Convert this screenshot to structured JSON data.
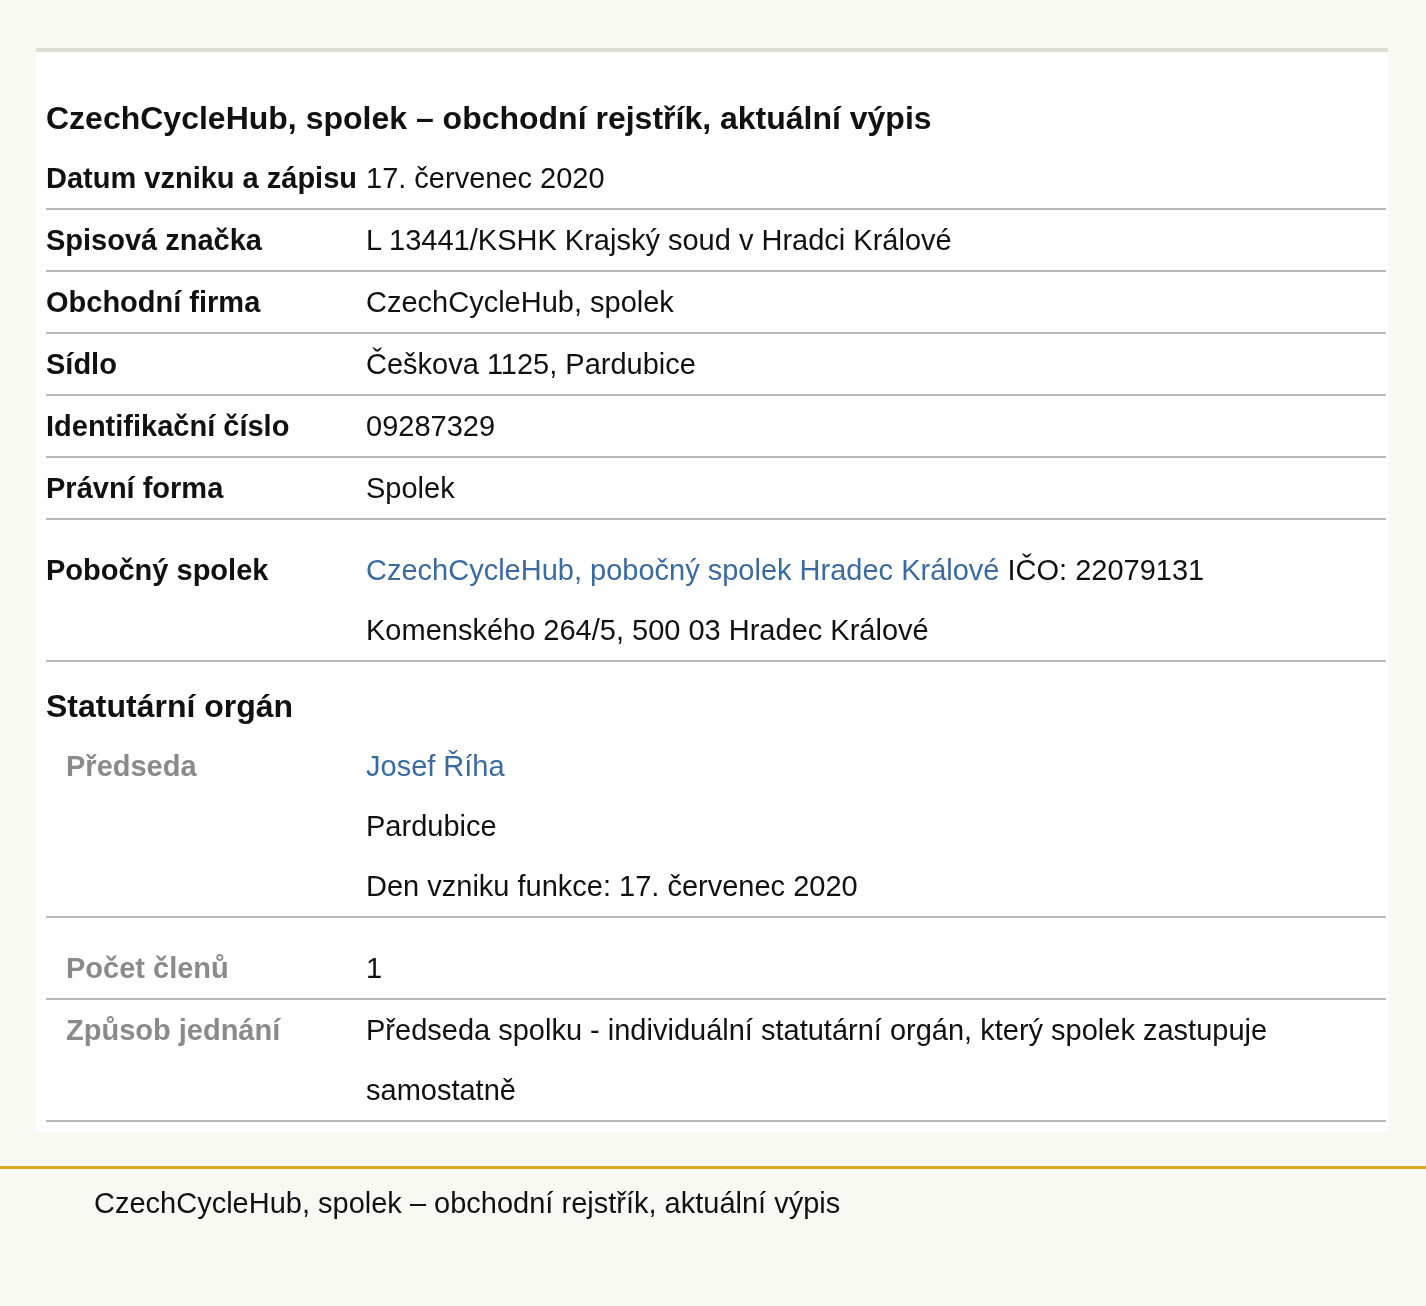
{
  "title": "CzechCycleHub, spolek – obchodní rejstřík, aktuální výpis",
  "rows": [
    {
      "label": "Datum vzniku a zápisu",
      "lines": [
        [
          {
            "kind": "text",
            "text": "17. červenec 2020"
          }
        ]
      ]
    },
    {
      "label": "Spisová značka",
      "lines": [
        [
          {
            "kind": "text",
            "text": "L 13441/KSHK Krajský soud v Hradci Králové"
          }
        ]
      ]
    },
    {
      "label": "Obchodní firma",
      "lines": [
        [
          {
            "kind": "text",
            "text": "CzechCycleHub, spolek"
          }
        ]
      ]
    },
    {
      "label": "Sídlo",
      "lines": [
        [
          {
            "kind": "text",
            "text": "Češkova 1125, Pardubice"
          }
        ]
      ]
    },
    {
      "label": "Identifikační číslo",
      "lines": [
        [
          {
            "kind": "text",
            "text": "09287329"
          }
        ]
      ]
    },
    {
      "label": "Právní forma",
      "lines": [
        [
          {
            "kind": "text",
            "text": "Spolek"
          }
        ]
      ]
    },
    {
      "label": "Pobočný spolek",
      "spaced": true,
      "lines": [
        [
          {
            "kind": "link",
            "text": "CzechCycleHub, pobočný spolek Hradec Králové"
          },
          {
            "kind": "text",
            "text": "IČO: 22079131"
          }
        ],
        [
          {
            "kind": "text",
            "text": "Komenského 264/5, 500 03 Hradec Králové"
          }
        ]
      ]
    }
  ],
  "section": {
    "heading": "Statutární orgán",
    "rows": [
      {
        "label": "Předseda",
        "lines": [
          [
            {
              "kind": "link",
              "text": "Josef Říha"
            }
          ],
          [
            {
              "kind": "text",
              "text": "Pardubice"
            }
          ],
          [
            {
              "kind": "text",
              "text": "Den vzniku funkce: 17. červenec 2020"
            }
          ]
        ]
      },
      {
        "label": "Počet členů",
        "spaced": true,
        "lines": [
          [
            {
              "kind": "text",
              "text": "1"
            }
          ]
        ]
      },
      {
        "label": "Způsob jednání",
        "lines": [
          [
            {
              "kind": "text",
              "text": "Předseda spolku - individuální statutární orgán, který spolek zastupuje samostatně"
            }
          ]
        ]
      }
    ]
  },
  "footer": "CzechCycleHub, spolek – obchodní rejstřík, aktuální výpis"
}
